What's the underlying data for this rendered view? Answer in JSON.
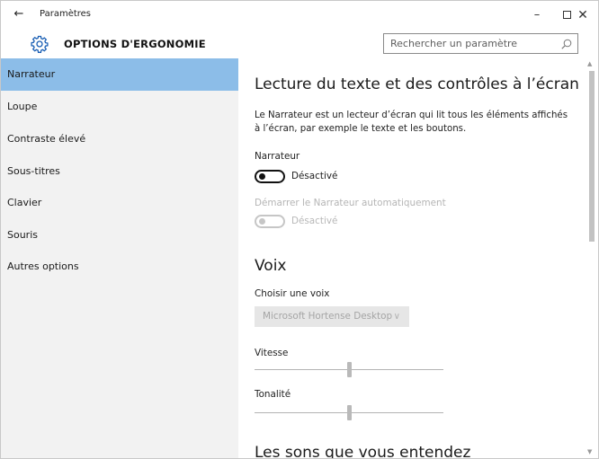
{
  "titlebar": {
    "back_icon": "back-arrow-icon",
    "app_title": "Paramètres",
    "minimize_glyph": "–",
    "close_glyph": "✕"
  },
  "header": {
    "icon": "gear-icon",
    "page_title": "OPTIONS D'ERGONOMIE",
    "search_placeholder": "Rechercher un paramètre"
  },
  "sidebar": {
    "items": [
      {
        "label": "Narrateur",
        "selected": true
      },
      {
        "label": "Loupe"
      },
      {
        "label": "Contraste élevé"
      },
      {
        "label": "Sous-titres"
      },
      {
        "label": "Clavier"
      },
      {
        "label": "Souris"
      },
      {
        "label": "Autres options"
      }
    ],
    "selected_color": "#8cbde8"
  },
  "content": {
    "section1_title": "Lecture du texte et des contrôles à l’écran",
    "section1_description": "Le Narrateur est un lecteur d’écran qui lit tous les éléments affichés à l’écran, par exemple le texte et les boutons.",
    "narrator_label": "Narrateur",
    "narrator_state": "Désactivé",
    "autostart_label": "Démarrer le Narrateur automatiquement",
    "autostart_state": "Désactivé",
    "section2_title": "Voix",
    "voice_label": "Choisir une voix",
    "voice_value": "Microsoft Hortense Desktop",
    "speed_label": "Vitesse",
    "speed_value_pct": 50,
    "pitch_label": "Tonalité",
    "pitch_value_pct": 50,
    "section3_title": "Les sons que vous entendez"
  }
}
